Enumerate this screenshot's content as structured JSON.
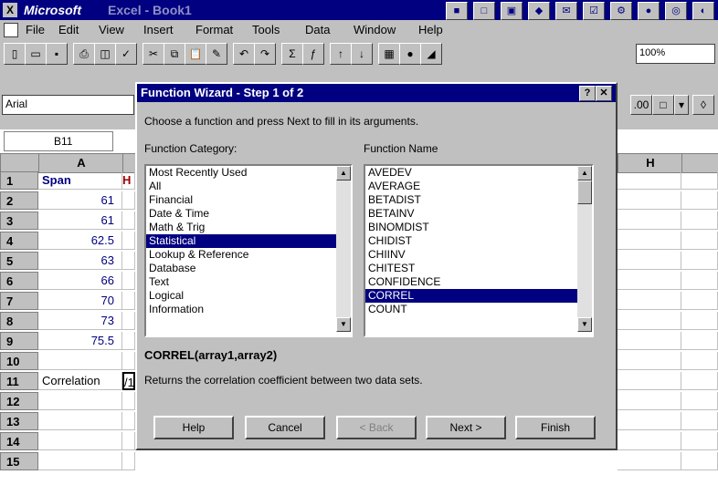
{
  "window": {
    "app_name": "Microsoft",
    "app_suffix": "Excel",
    "doc_name": "Book1"
  },
  "menu": [
    "File",
    "Edit",
    "View",
    "Insert",
    "Format",
    "Tools",
    "Data",
    "Window",
    "Help"
  ],
  "toolbar": {
    "zoom": "100%"
  },
  "fmtbar": {
    "font": "Arial"
  },
  "namebox": "B11",
  "grid": {
    "col_a": "A",
    "col_h": "H",
    "rows": [
      "1",
      "2",
      "3",
      "4",
      "5",
      "6",
      "7",
      "8",
      "9",
      "10",
      "11",
      "12",
      "13",
      "14",
      "15"
    ],
    "a_values": [
      "Span",
      "61",
      "61",
      "62.5",
      "63",
      "66",
      "70",
      "73",
      "75.5",
      "",
      "Correlation",
      "",
      "",
      "",
      ""
    ],
    "b1_partial": "H",
    "b11_partial": "/1"
  },
  "dialog": {
    "title": "Function Wizard - Step 1 of 2",
    "instructions": "Choose a function and press Next to fill in its arguments.",
    "category_label": "Function Category:",
    "name_label": "Function Name",
    "categories": [
      "Most Recently Used",
      "All",
      "Financial",
      "Date & Time",
      "Math & Trig",
      "Statistical",
      "Lookup & Reference",
      "Database",
      "Text",
      "Logical",
      "Information"
    ],
    "selected_category": "Statistical",
    "functions": [
      "AVEDEV",
      "AVERAGE",
      "BETADIST",
      "BETAINV",
      "BINOMDIST",
      "CHIDIST",
      "CHIINV",
      "CHITEST",
      "CONFIDENCE",
      "CORREL",
      "COUNT"
    ],
    "selected_function": "CORREL",
    "syntax": "CORREL(array1,array2)",
    "description": "Returns the correlation coefficient between two data sets.",
    "buttons": {
      "help": "Help",
      "cancel": "Cancel",
      "back": "< Back",
      "next": "Next >",
      "finish": "Finish"
    }
  }
}
